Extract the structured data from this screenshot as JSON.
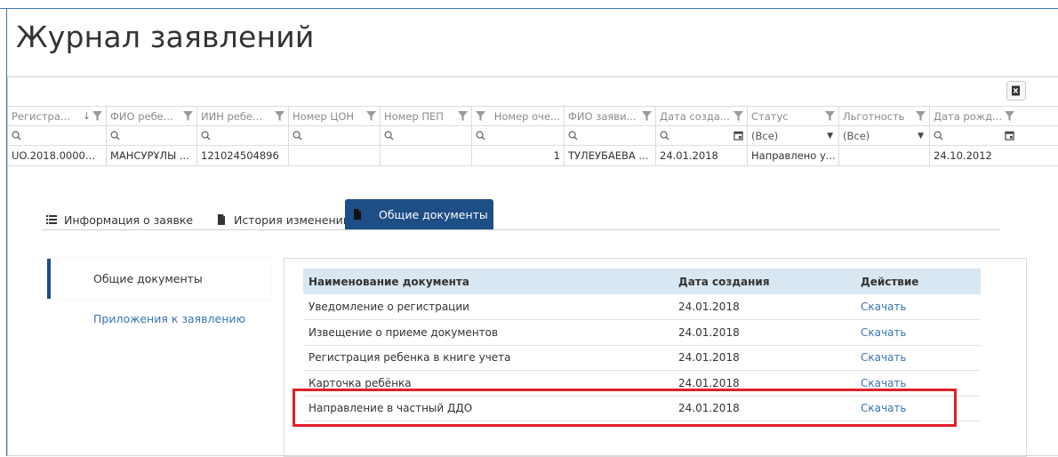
{
  "page": {
    "title": "Журнал заявлений"
  },
  "toolbar": {
    "export_icon": "excel-export-icon"
  },
  "grid": {
    "columns": [
      {
        "label": "Регистра...",
        "sort": "↓"
      },
      {
        "label": "ФИО ребе..."
      },
      {
        "label": "ИИН ребе..."
      },
      {
        "label": "Номер ЦОН"
      },
      {
        "label": "Номер ПЕП"
      },
      {
        "label": "Номер оче..."
      },
      {
        "label": "ФИО заяви..."
      },
      {
        "label": "Дата созда..."
      },
      {
        "label": "Статус"
      },
      {
        "label": "Льготность"
      },
      {
        "label": "Дата рожд..."
      }
    ],
    "filters": {
      "status_value": "(Все)",
      "benefit_value": "(Все)"
    },
    "row": [
      "UO.2018.0000...",
      "МАНСУРҰЛЫ ...",
      "121024504896",
      "",
      "",
      "1",
      "ТУЛЕУБАЕВА ...",
      "24.01.2018",
      "Направлено у...",
      "",
      "24.10.2012"
    ]
  },
  "tabs": [
    {
      "label": "Информация о заявке",
      "icon": "list-icon"
    },
    {
      "label": "История изменений",
      "icon": "document-icon"
    },
    {
      "label": "Общие документы",
      "icon": "document-icon",
      "active": true
    }
  ],
  "side": {
    "items": [
      {
        "label": "Общие документы",
        "active": true
      },
      {
        "label": "Приложения к заявлению"
      }
    ]
  },
  "documents": {
    "headers": [
      "Наименование документа",
      "Дата создания",
      "Действие"
    ],
    "rows": [
      {
        "name": "Уведомление о регистрации",
        "date": "24.01.2018",
        "action": "Скачать"
      },
      {
        "name": "Извещение о приеме документов",
        "date": "24.01.2018",
        "action": "Скачать"
      },
      {
        "name": "Регистрация ребенка в книге учета",
        "date": "24.01.2018",
        "action": "Скачать"
      },
      {
        "name": "Карточка ребёнка",
        "date": "24.01.2018",
        "action": "Скачать"
      },
      {
        "name": "Направление в частный ДДО",
        "date": "24.01.2018",
        "action": "Скачать"
      }
    ]
  },
  "colors": {
    "accent": "#1d4e86",
    "link": "#3a74b0",
    "highlight": "#e0202a",
    "table_header": "#d9e7f2"
  }
}
